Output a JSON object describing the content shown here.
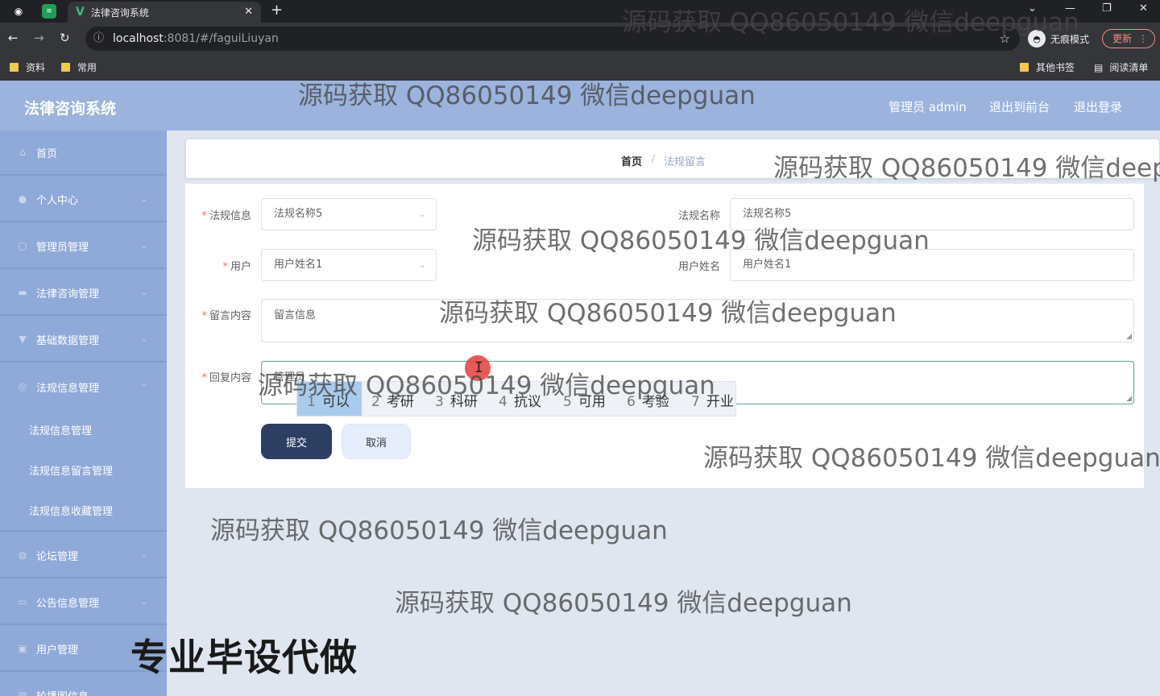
{
  "browser": {
    "tab_title": "法律咨询系统",
    "url_host": "localhost",
    "url_rest": ":8081/#/faguiLiuyan",
    "incognito_label": "无痕模式",
    "update_label": "更新",
    "bookmarks": [
      "资料",
      "常用"
    ],
    "bookmarks_right": [
      "其他书签",
      "阅读清单"
    ]
  },
  "header": {
    "app_title": "法律咨询系统",
    "admin_label": "管理员 admin",
    "front_link": "退出到前台",
    "logout_link": "退出登录"
  },
  "sidebar": {
    "items": [
      {
        "label": "首页",
        "icon": "home-icon"
      },
      {
        "label": "个人中心",
        "icon": "user-icon"
      },
      {
        "label": "管理员管理",
        "icon": "admin-icon"
      },
      {
        "label": "法律咨询管理",
        "icon": "chat-icon"
      },
      {
        "label": "基础数据管理",
        "icon": "database-icon"
      },
      {
        "label": "法规信息管理",
        "icon": "info-icon"
      }
    ],
    "sub_items": [
      "法规信息管理",
      "法规信息留言管理",
      "法规信息收藏管理"
    ],
    "items_after": [
      {
        "label": "论坛管理",
        "icon": "forum-icon"
      },
      {
        "label": "公告信息管理",
        "icon": "notice-icon"
      },
      {
        "label": "用户管理",
        "icon": "users-icon"
      },
      {
        "label": "轮播图信息",
        "icon": "image-icon"
      }
    ]
  },
  "breadcrumb": {
    "home": "首页",
    "separator": "/",
    "current": "法规留言"
  },
  "form": {
    "law_info_label": "法规信息",
    "law_info_value": "法规名称5",
    "law_name_label": "法规名称",
    "law_name_value": "法规名称5",
    "user_label": "用户",
    "user_value": "用户姓名1",
    "user_name_label": "用户姓名",
    "user_name_value": "用户姓名1",
    "message_label": "留言内容",
    "message_value": "留言信息",
    "reply_label": "回复内容",
    "reply_value": "管理员",
    "submit_label": "提交",
    "cancel_label": "取消"
  },
  "ime": {
    "candidates": [
      {
        "n": "1",
        "w": "可以"
      },
      {
        "n": "2",
        "w": "考研"
      },
      {
        "n": "3",
        "w": "科研"
      },
      {
        "n": "4",
        "w": "抗议"
      },
      {
        "n": "5",
        "w": "可用"
      },
      {
        "n": "6",
        "w": "考验"
      },
      {
        "n": "7",
        "w": "开业"
      }
    ]
  },
  "watermark": {
    "text": "源码获取 QQ86050149 微信deepguan",
    "text_cut": "源码获取 QQ86050149 微信deepg",
    "big_text": "专业毕设代做"
  }
}
